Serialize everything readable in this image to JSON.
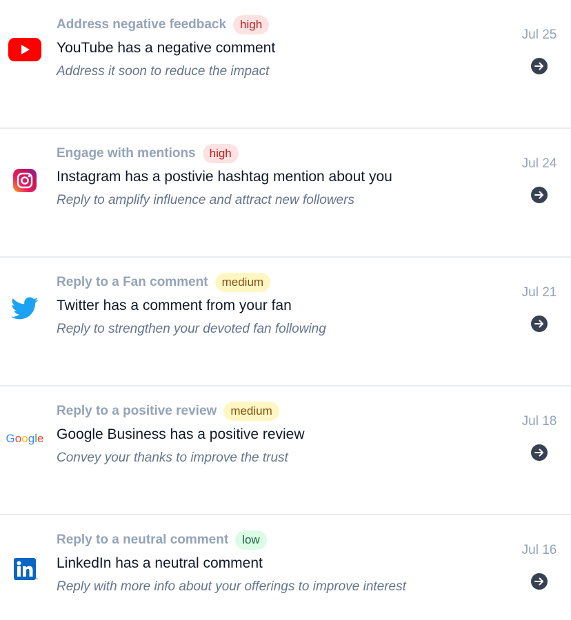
{
  "items": [
    {
      "platform_icon": "youtube-icon",
      "category": "Address negative feedback",
      "priority": "high",
      "title": "YouTube has a negative comment",
      "subtitle": "Address it soon to reduce the impact",
      "date": "Jul 25"
    },
    {
      "platform_icon": "instagram-icon",
      "category": "Engage with mentions",
      "priority": "high",
      "title": "Instagram has a postivie hashtag mention about you",
      "subtitle": "Reply to amplify influence and attract new followers",
      "date": "Jul 24"
    },
    {
      "platform_icon": "twitter-icon",
      "category": "Reply to a Fan comment",
      "priority": "medium",
      "title": "Twitter has a comment from your fan",
      "subtitle": "Reply to strengthen your devoted fan following",
      "date": "Jul 21"
    },
    {
      "platform_icon": "google-icon",
      "logo_text": "Google",
      "category": "Reply to a positive review",
      "priority": "medium",
      "title": "Google Business has a positive review",
      "subtitle": "Convey your thanks to improve the trust",
      "date": "Jul 18"
    },
    {
      "platform_icon": "linkedin-icon",
      "logo_text": "in",
      "category": "Reply to a neutral comment",
      "priority": "low",
      "title": "LinkedIn has a neutral comment",
      "subtitle": "Reply with more info about your offerings to improve interest",
      "date": "Jul 16"
    }
  ],
  "colors": {
    "high_bg": "#fde2e2",
    "high_text": "#b91c1c",
    "medium_bg": "#fef7c3",
    "medium_text": "#854d0e",
    "low_bg": "#dcfce7",
    "low_text": "#166534"
  }
}
